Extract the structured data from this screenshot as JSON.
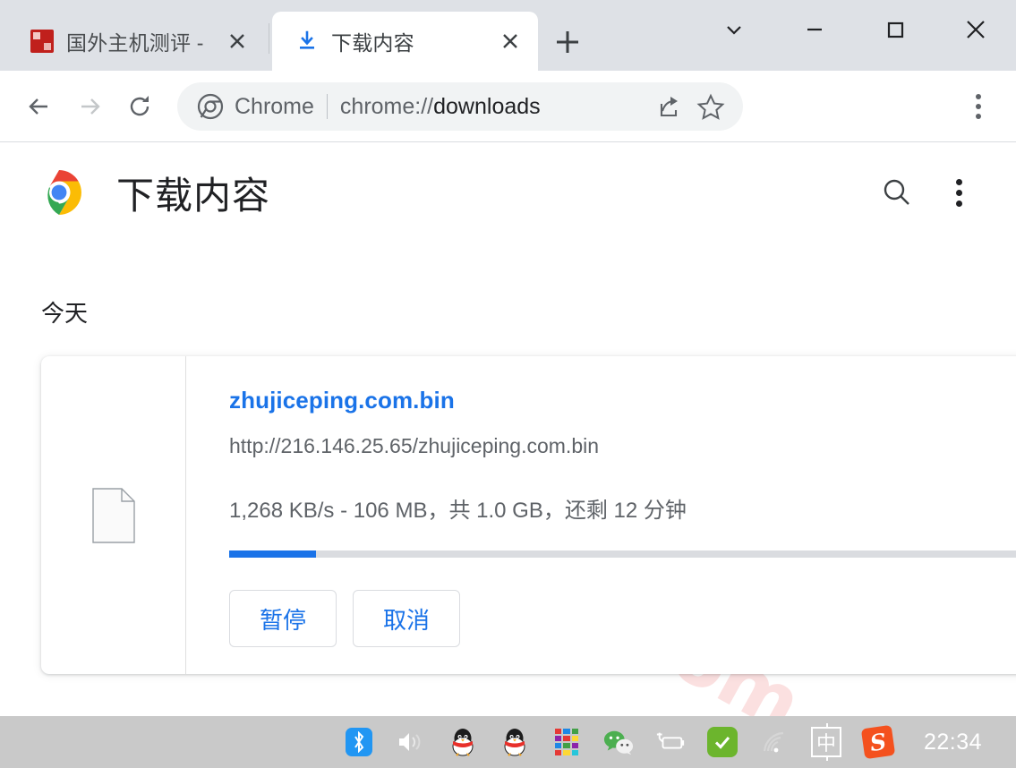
{
  "window": {
    "controls": [
      {
        "name": "tab-search",
        "glyph": "chevron-down"
      },
      {
        "name": "minimize",
        "glyph": "minimize"
      },
      {
        "name": "maximize",
        "glyph": "maximize"
      },
      {
        "name": "close",
        "glyph": "close"
      }
    ]
  },
  "tabs": [
    {
      "title": "国外主机测评 -",
      "active": false,
      "favicon": "site-favicon-red"
    },
    {
      "title": "下载内容",
      "active": true,
      "favicon": "download-icon"
    }
  ],
  "newtab_tooltip": "+",
  "toolbar": {
    "back_icon": "back-arrow-icon",
    "forward_icon": "forward-arrow-icon",
    "reload_icon": "reload-icon",
    "omnibox": {
      "brand": "Chrome",
      "url_prefix": "chrome://",
      "url_page": "downloads",
      "full_url": "chrome://downloads",
      "share_icon": "share-icon",
      "bookmark_icon": "star-icon"
    },
    "menu_icon": "three-dot-menu-icon"
  },
  "downloads_page": {
    "title": "下载内容",
    "logo": "chrome-logo",
    "search_icon": "search-icon",
    "menu_icon": "three-dot-menu-icon",
    "watermark": "zhujiceping.com",
    "day_group": "今天",
    "items": [
      {
        "file_icon": "generic-file-icon",
        "filename": "zhujiceping.com.bin",
        "url": "http://216.146.25.65/zhujiceping.com.bin",
        "status": "1,268 KB/s - 106 MB，共 1.0 GB，还剩 12 分钟",
        "speed": "1,268 KB/s",
        "downloaded": "106 MB",
        "total_size": "1.0 GB",
        "time_left": "还剩 12 分钟",
        "progress_percent": 11,
        "progress_color": "#1a73e8",
        "track_color": "#dadce0",
        "buttons": [
          {
            "label": "暂停",
            "name": "pause-button"
          },
          {
            "label": "取消",
            "name": "cancel-button"
          }
        ]
      }
    ]
  },
  "taskbar": {
    "tray_icons": [
      {
        "name": "bluetooth-icon"
      },
      {
        "name": "volume-icon"
      },
      {
        "name": "qq-icon"
      },
      {
        "name": "qq-icon-2"
      },
      {
        "name": "color-grid-icon"
      },
      {
        "name": "wechat-icon"
      },
      {
        "name": "battery-icon"
      },
      {
        "name": "security-check-icon"
      },
      {
        "name": "wifi-icon"
      },
      {
        "name": "ime-indicator"
      },
      {
        "name": "sogou-input-icon"
      }
    ],
    "ime_label": "中",
    "sogou_label": "S",
    "clock": "22:34",
    "notification_icon": "notification-icon"
  }
}
